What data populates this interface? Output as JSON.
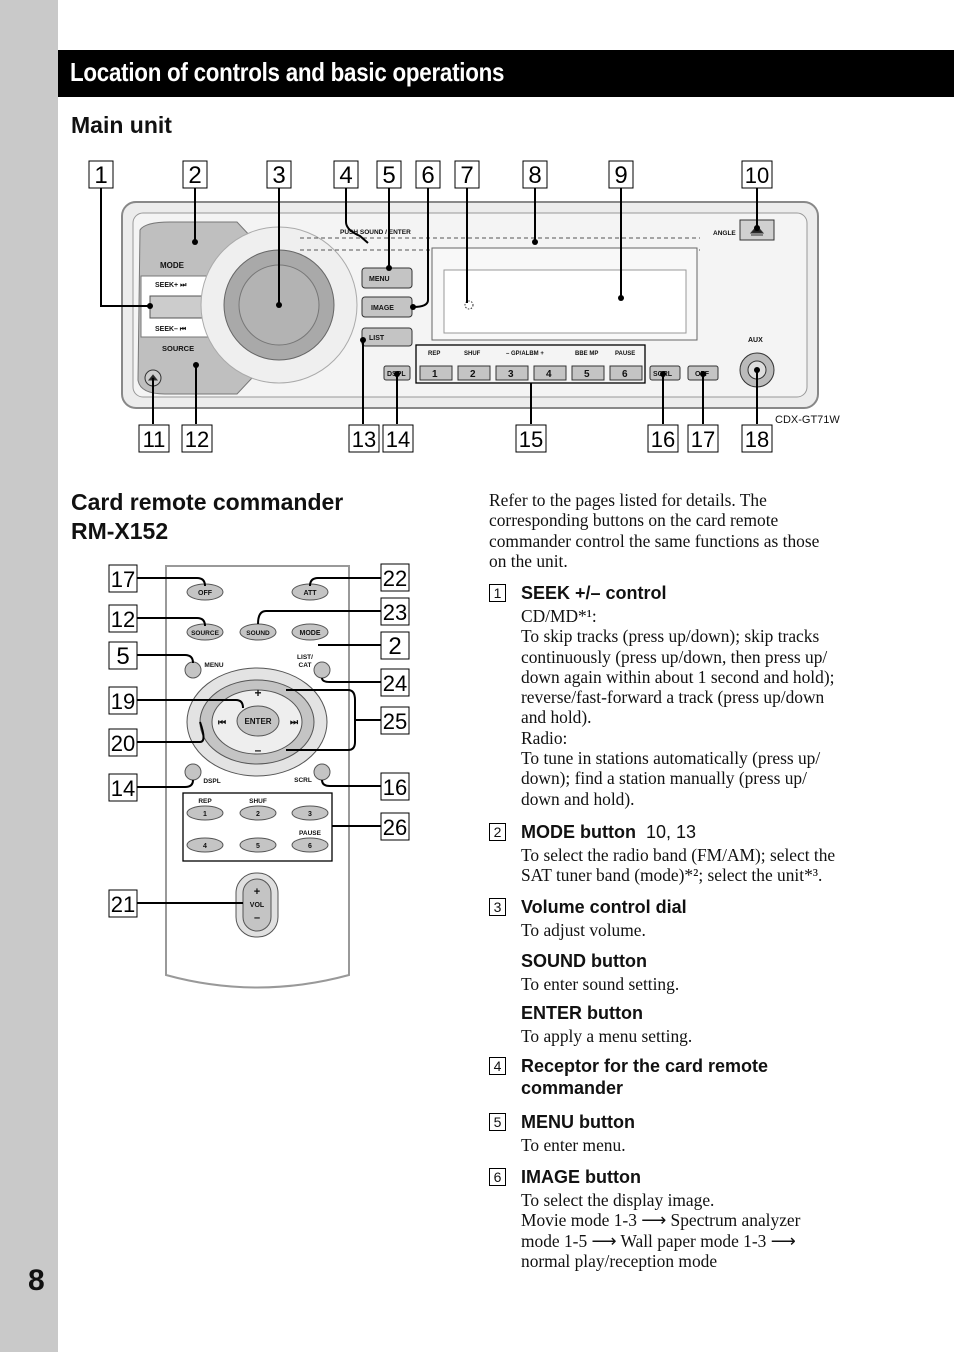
{
  "page_number": "8",
  "section_title": "Location of controls and basic operations",
  "main_unit": {
    "heading": "Main unit",
    "model": "CDX-GT71W",
    "callouts_top": [
      "1",
      "2",
      "3",
      "4",
      "5",
      "6",
      "7",
      "8",
      "9",
      "10"
    ],
    "callouts_bottom": [
      "11",
      "12",
      "13",
      "14",
      "15",
      "16",
      "17",
      "18"
    ],
    "labels": {
      "mode": "MODE",
      "seek_plus": "SEEK+ ⏭",
      "seek_minus": "SEEK– ⏮",
      "source": "SOURCE",
      "push": "PUSH SOUND / ENTER",
      "menu": "MENU",
      "image": "IMAGE",
      "list": "LIST",
      "angle": "ANGLE",
      "aux": "AUX",
      "dspl": "DSPL",
      "scrl": "SCRL",
      "off": "OFF",
      "preset_top": [
        "REP",
        "SHUF",
        "– GP/ALBM +",
        "BBE MP",
        "PAUSE"
      ],
      "presets": [
        "1",
        "2",
        "3",
        "4",
        "5",
        "6"
      ]
    }
  },
  "remote": {
    "heading_lines": [
      "Card remote commander",
      "RM-X152"
    ],
    "callouts_left": [
      "17",
      "12",
      "5",
      "19",
      "20",
      "14",
      "21"
    ],
    "callouts_right": [
      "22",
      "23",
      "2",
      "24",
      "25",
      "16",
      "26"
    ],
    "labels": {
      "off": "OFF",
      "att": "ATT",
      "source": "SOURCE",
      "sound": "SOUND",
      "mode": "MODE",
      "menu": "MENU",
      "list_cat": [
        "LIST/",
        "CAT"
      ],
      "enter": "ENTER",
      "prev": "⏮",
      "next": "⏭",
      "plus": "+",
      "minus": "–",
      "dspl": "DSPL",
      "scrl": "SCRL",
      "rep": "REP",
      "shuf": "SHUF",
      "pause": "PAUSE",
      "numbers": [
        "1",
        "2",
        "3",
        "4",
        "5",
        "6"
      ],
      "vol": "VOL",
      "vol_plus": "+",
      "vol_minus": "–"
    }
  },
  "intro_lines": [
    "Refer to the pages listed for details. The",
    "corresponding buttons on the card remote",
    "commander control the same functions as those",
    "on the unit."
  ],
  "items": [
    {
      "num": "1",
      "title": "SEEK +/– control",
      "refs": "",
      "lines": [
        "CD/MD*¹:",
        "To skip tracks (press up/down); skip tracks",
        "continuously (press up/down, then press up/",
        "down again within about 1 second and hold);",
        "reverse/fast-forward a track (press up/down",
        "and hold).",
        "Radio:",
        "To tune in stations automatically (press up/",
        "down); find a station manually (press up/",
        "down and hold)."
      ]
    },
    {
      "num": "2",
      "title": "MODE button",
      "refs": "10, 13",
      "lines": [
        "To select the radio band (FM/AM); select the",
        "SAT tuner band (mode)*²; select the unit*³."
      ]
    },
    {
      "num": "3",
      "title": "Volume control dial",
      "refs": "",
      "lines": [
        "To adjust volume."
      ]
    },
    {
      "num": "",
      "title": "SOUND button",
      "refs": "",
      "lines": [
        "To enter sound setting."
      ]
    },
    {
      "num": "",
      "title": "ENTER button",
      "refs": "",
      "lines": [
        "To apply a menu setting."
      ]
    },
    {
      "num": "4",
      "title": "Receptor for the card remote",
      "title2": "commander",
      "refs": "",
      "lines": []
    },
    {
      "num": "5",
      "title": "MENU button",
      "refs": "",
      "lines": [
        "To enter menu."
      ]
    },
    {
      "num": "6",
      "title": "IMAGE button",
      "refs": "",
      "lines": [
        "To select the display image.",
        "Movie mode 1-3 ⟶ Spectrum analyzer",
        "mode 1-5 ⟶ Wall paper mode 1-3 ⟶",
        "normal play/reception mode"
      ]
    }
  ]
}
